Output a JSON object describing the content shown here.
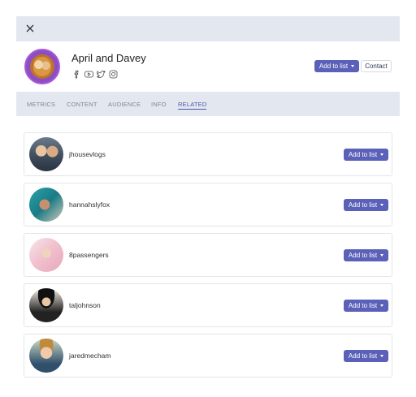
{
  "header": {
    "close_icon": "close-icon"
  },
  "profile": {
    "name": "April and Davey",
    "social_icons": [
      "facebook-icon",
      "youtube-icon",
      "twitter-icon",
      "instagram-icon"
    ],
    "add_to_list_label": "Add to list",
    "contact_label": "Contact"
  },
  "tabs": [
    {
      "label": "METRICS",
      "active": false
    },
    {
      "label": "CONTENT",
      "active": false
    },
    {
      "label": "AUDIENCE",
      "active": false
    },
    {
      "label": "INFO",
      "active": false
    },
    {
      "label": "RELATED",
      "active": true
    }
  ],
  "related": [
    {
      "username": "jhousevlogs",
      "button_label": "Add to list"
    },
    {
      "username": "hannahslyfox",
      "button_label": "Add to list"
    },
    {
      "username": "8passengers",
      "button_label": "Add to list"
    },
    {
      "username": "taljohnson",
      "button_label": "Add to list"
    },
    {
      "username": "jaredmecham",
      "button_label": "Add to list"
    }
  ],
  "colors": {
    "accent": "#5b61b8",
    "bar_bg": "#e3e8f0"
  }
}
